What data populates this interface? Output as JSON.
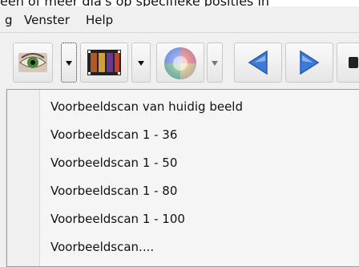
{
  "top_caption": "een of meer dia's op specifieke posities in",
  "menubar": {
    "items": [
      "g",
      "Venster",
      "Help"
    ]
  },
  "toolbar": {
    "buttons": [
      "eye-icon",
      "film-icon",
      "color-wheel-icon",
      "arrow-left-icon",
      "arrow-right-icon"
    ]
  },
  "menu": {
    "items": [
      "Voorbeeldscan van huidig beeld",
      "Voorbeeldscan 1 - 36",
      "Voorbeeldscan 1 - 50",
      "Voorbeeldscan 1 - 80",
      "Voorbeeldscan 1 - 100",
      "Voorbeeldscan...."
    ]
  }
}
